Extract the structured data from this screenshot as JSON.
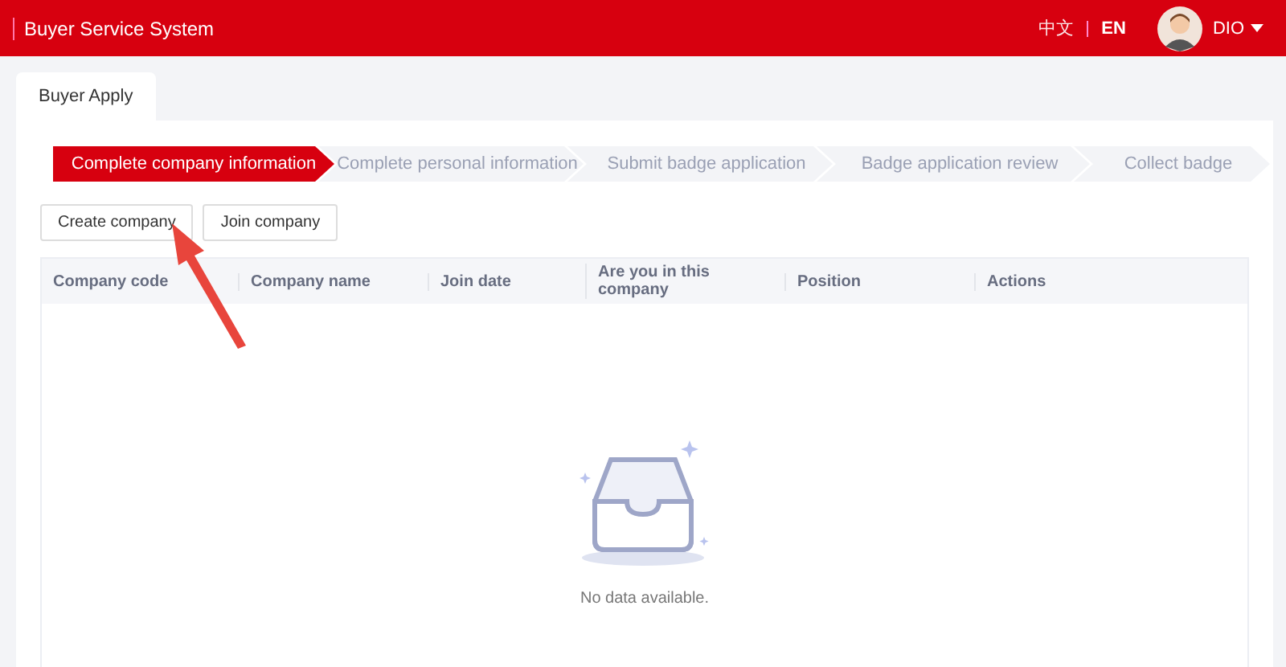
{
  "header": {
    "title": "Buyer Service System",
    "languages": [
      {
        "label": "中文",
        "selected": false
      },
      {
        "label": "EN",
        "selected": true
      }
    ],
    "user": "DIO"
  },
  "tabs": [
    {
      "label": "Buyer Apply",
      "selected": true
    }
  ],
  "steps": [
    {
      "label": "Complete company information",
      "selected": true
    },
    {
      "label": "Complete personal information",
      "selected": false
    },
    {
      "label": "Submit badge application",
      "selected": false
    },
    {
      "label": "Badge application review",
      "selected": false
    },
    {
      "label": "Collect badge",
      "selected": false
    }
  ],
  "buttons": [
    "Create company",
    "Join company"
  ],
  "table": {
    "columns": [
      "Company code",
      "Company name",
      "Join date",
      "Are you in this company",
      "Position",
      "Actions"
    ],
    "empty_text": "No data available."
  }
}
